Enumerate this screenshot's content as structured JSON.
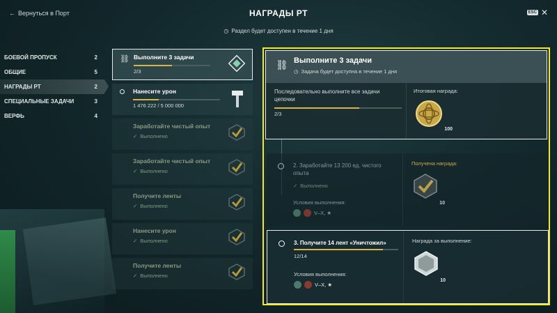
{
  "header": {
    "back_label": "Вернуться в Порт",
    "title": "НАГРАДЫ РТ",
    "esc_label": "ESC",
    "subtitle": "Раздел будет доступен в течение 1 дня"
  },
  "sidebar": {
    "items": [
      {
        "label": "БОЕВОЙ ПРОПУСК",
        "count": "2"
      },
      {
        "label": "ОБЩИЕ",
        "count": "5"
      },
      {
        "label": "НАГРАДЫ РТ",
        "count": "2"
      },
      {
        "label": "СПЕЦИАЛЬНЫЕ ЗАДАЧИ",
        "count": "3"
      },
      {
        "label": "ВЕРФЬ",
        "count": "4"
      }
    ],
    "active_index": 2
  },
  "tasks": [
    {
      "title": "Выполните 3 задачи",
      "count": "2/3",
      "progress": 0.67,
      "state": "selected"
    },
    {
      "title": "Нанесите урон",
      "count": "1 476 222 / 5 000 000",
      "progress": 0.3,
      "state": "active"
    },
    {
      "title": "Заработайте чистый опыт",
      "status": "Выполнено",
      "state": "done"
    },
    {
      "title": "Заработайте чистый опыт",
      "status": "Выполнено",
      "state": "done"
    },
    {
      "title": "Получите ленты",
      "status": "Выполнено",
      "state": "done"
    },
    {
      "title": "Нанесите урон",
      "status": "Выполнено",
      "state": "done"
    },
    {
      "title": "Получите ленты",
      "status": "Выполнено",
      "state": "done"
    }
  ],
  "detail": {
    "title": "Выполните 3 задачи",
    "availability": "Задача будет доступна в течение 1 дня",
    "description": "Последовательно выполните все задачи цепочки",
    "count": "2/3",
    "progress": 0.67,
    "final_reward_label": "Итоговая награда:",
    "final_reward_qty": "100",
    "step2": {
      "title": "2. Заработайте 13 200 ед. чистого опыта",
      "status": "Выполнено",
      "conditions_label": "Условия выполнения:",
      "tiers": "V–X, ★",
      "reward_label": "Получена награда:",
      "reward_qty": "10"
    },
    "step3": {
      "title": "3. Получите 14 лент «Уничтожил»",
      "count": "12/14",
      "progress": 0.857,
      "conditions_label": "Условия выполнения:",
      "tiers": "V–X, ★",
      "reward_label": "Награда за выполнение:",
      "reward_qty": "10"
    }
  },
  "colors": {
    "accent_gold": "#d7b54a",
    "highlight_border": "#f5ea1f",
    "done_green": "#7f9a80"
  },
  "icons": {
    "back": "arrow-left-icon",
    "close": "close-icon",
    "clock": "clock-icon",
    "chain": "chain-link-icon",
    "check": "checkmark-icon"
  }
}
